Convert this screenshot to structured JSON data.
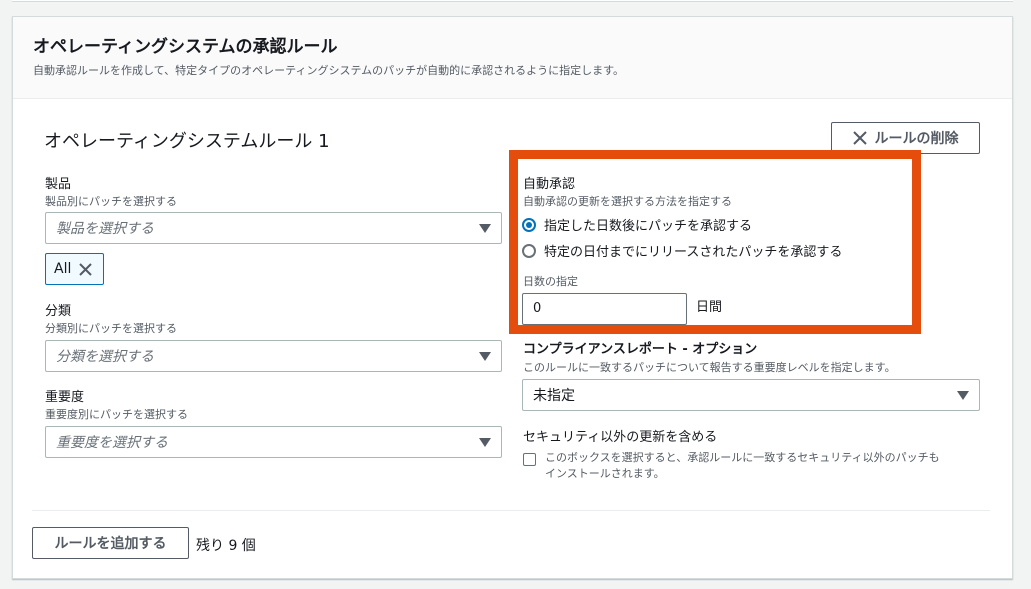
{
  "section": {
    "title": "オペレーティングシステムの承認ルール",
    "description": "自動承認ルールを作成して、特定タイプのオペレーティングシステムのパッチが自動的に承認されるように指定します。"
  },
  "rule": {
    "title": "オペレーティングシステムルール 1",
    "remove_label": "ルールの削除"
  },
  "product": {
    "label": "製品",
    "description": "製品別にパッチを選択する",
    "placeholder": "製品を選択する",
    "token": "All"
  },
  "classification": {
    "label": "分類",
    "description": "分類別にパッチを選択する",
    "placeholder": "分類を選択する"
  },
  "severity": {
    "label": "重要度",
    "description": "重要度別にパッチを選択する",
    "placeholder": "重要度を選択する"
  },
  "auto_approval": {
    "label": "自動承認",
    "description": "自動承認の更新を選択する方法を指定する",
    "options": [
      {
        "label": "指定した日数後にパッチを承認する",
        "selected": true
      },
      {
        "label": "特定の日付までにリリースされたパッチを承認する",
        "selected": false
      }
    ],
    "days_label": "日数の指定",
    "days_value": "0",
    "days_unit": "日間"
  },
  "compliance": {
    "label": "コンプライアンスレポート - オプション",
    "description": "このルールに一致するパッチについて報告する重要度レベルを指定します。",
    "value": "未指定"
  },
  "non_security": {
    "label": "セキュリティ以外の更新を含める",
    "checkbox_text": "このボックスを選択すると、承認ルールに一致するセキュリティ以外のパッチも",
    "checkbox_text2": "インストールされます。",
    "checked": false
  },
  "footer": {
    "add_label": "ルールを追加する",
    "remaining": "残り 9 個"
  },
  "colors": {
    "highlight": "#e44d0c",
    "accent": "#0073bb"
  }
}
